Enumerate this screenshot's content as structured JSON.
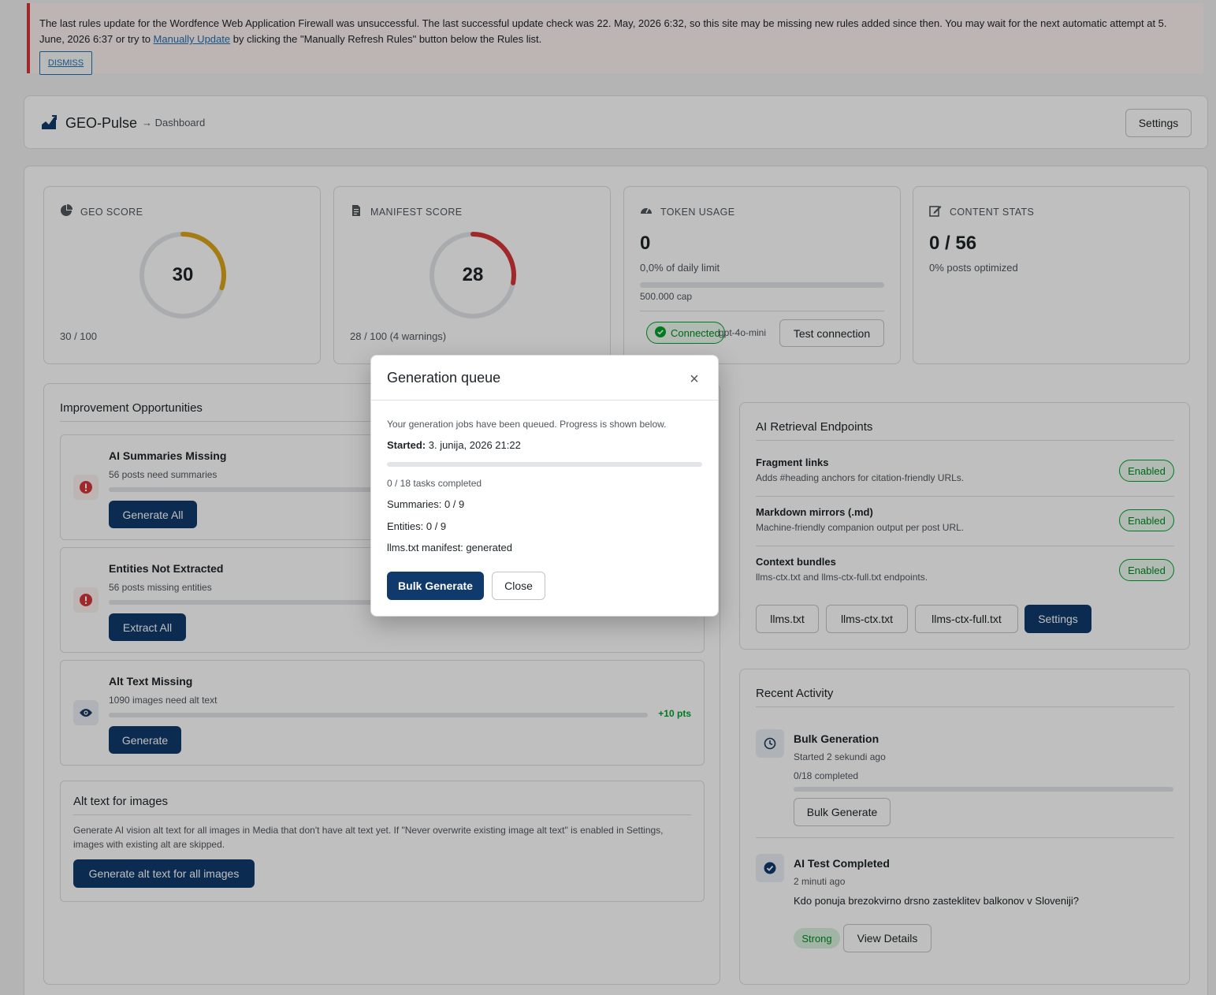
{
  "notice": {
    "text_before": "The last rules update for the Wordfence Web Application Firewall was unsuccessful. The last successful update check was 22. May, 2026 6:32, so this site may be missing new rules added since then. You may wait for the next automatic attempt at 5. June, 2026 6:37 or try to ",
    "link": "Manually Update",
    "text_after": " by clicking the \"Manually Refresh Rules\" button below the Rules list.",
    "dismiss": "DISMISS"
  },
  "header": {
    "brand": "GEO-Pulse",
    "breadcrumb": "→ Dashboard",
    "settings": "Settings"
  },
  "stats": {
    "geo": {
      "title": "GEO SCORE",
      "value": "30",
      "foot": "30 / 100",
      "fraction": 0.3,
      "color": "#dba617"
    },
    "manifest": {
      "title": "MANIFEST SCORE",
      "value": "28",
      "foot": "28 / 100 (4 warnings)",
      "fraction": 0.28,
      "color": "#d63638"
    },
    "token": {
      "title": "TOKEN USAGE",
      "value": "0",
      "pct": "0,0% of daily limit",
      "cap": "500.000 cap",
      "connected": "Connected",
      "model": "gpt-4o-mini",
      "test": "Test connection"
    },
    "content": {
      "title": "CONTENT STATS",
      "value": "0 / 56",
      "sub": "0% posts optimized"
    }
  },
  "opportunities": {
    "title": "Improvement Opportunities",
    "items": [
      {
        "title": "AI Summaries Missing",
        "sub": "56 posts need summaries",
        "button": "Generate All",
        "pts": ""
      },
      {
        "title": "Entities Not Extracted",
        "sub": "56 posts missing entities",
        "button": "Extract All",
        "pts": ""
      },
      {
        "title": "Alt Text Missing",
        "sub": "1090 images need alt text",
        "button": "Generate",
        "pts": "+10 pts"
      }
    ],
    "alt_section": {
      "title": "Alt text for images",
      "desc": "Generate AI vision alt text for all images in Media that don't have alt text yet. If \"Never overwrite existing image alt text\" is enabled in Settings, images with existing alt are skipped.",
      "button": "Generate alt text for all images"
    }
  },
  "endpoints": {
    "title": "AI Retrieval Endpoints",
    "items": [
      {
        "title": "Fragment links",
        "desc": "Adds #heading anchors for citation-friendly URLs.",
        "badge": "Enabled"
      },
      {
        "title": "Markdown mirrors (.md)",
        "desc": "Machine-friendly companion output per post URL.",
        "badge": "Enabled"
      },
      {
        "title": "Context bundles",
        "desc": "llms-ctx.txt and llms-ctx-full.txt endpoints.",
        "badge": "Enabled"
      }
    ],
    "buttons": [
      "llms.txt",
      "llms-ctx.txt",
      "llms-ctx-full.txt",
      "Settings"
    ]
  },
  "activity": {
    "title": "Recent Activity",
    "bulk": {
      "title": "Bulk Generation",
      "time": "Started 2 sekundi ago",
      "progress": "0/18 completed",
      "button": "Bulk Generate"
    },
    "test": {
      "title": "AI Test Completed",
      "time": "2 minuti ago",
      "question": "Kdo ponuja brezokvirno drsno zasteklitev balkonov v Sloveniji?",
      "badge": "Strong",
      "button": "View Details"
    }
  },
  "modal": {
    "title": "Generation queue",
    "intro": "Your generation jobs have been queued. Progress is shown below.",
    "started_label": "Started:",
    "started_value": " 3. junija, 2026 21:22",
    "progress_fraction": 0,
    "tasks": "0 / 18 tasks completed",
    "summaries": "Summaries: 0 / 9",
    "entities": "Entities: 0 / 9",
    "manifest": "llms.txt manifest: generated",
    "bulk_button": "Bulk Generate",
    "close_button": "Close"
  }
}
